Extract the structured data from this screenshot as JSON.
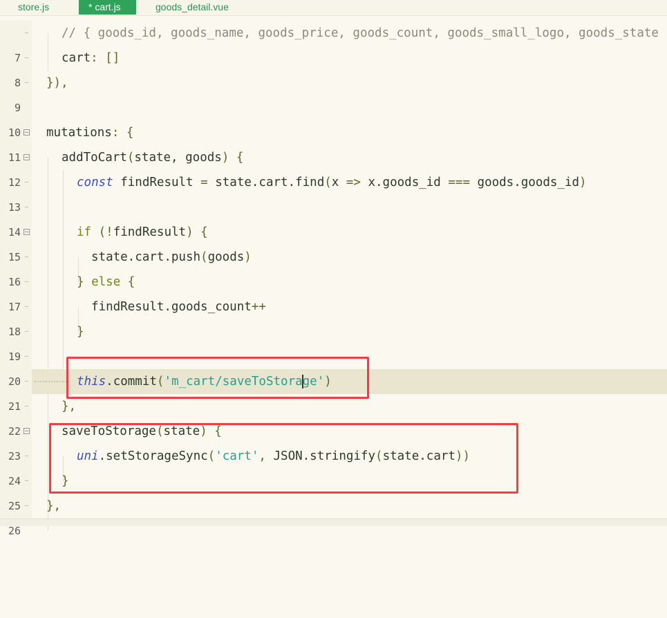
{
  "tabs": [
    {
      "label": "store.js",
      "active": false
    },
    {
      "label": "* cart.js",
      "active": true
    },
    {
      "label": "goods_detail.vue",
      "active": false
    }
  ],
  "colors": {
    "tab_active": "#2fa35a",
    "highlight_box": "#ef3e48",
    "current_line": "#e9e5cf"
  },
  "lines": [
    {
      "num": "7",
      "text": "    // { goods_id, goods_name, goods_price, goods_count, goods_small_logo, goods_state"
    },
    {
      "num": "8",
      "text": "    cart: []"
    },
    {
      "num": "9",
      "text": "  }),"
    },
    {
      "num": "10",
      "text": ""
    },
    {
      "num": "11",
      "text": "  mutations: {"
    },
    {
      "num": "12",
      "text": "    addToCart(state, goods) {"
    },
    {
      "num": "13",
      "text": "      const findResult = state.cart.find(x => x.goods_id === goods.goods_id)"
    },
    {
      "num": "14",
      "text": ""
    },
    {
      "num": "15",
      "text": "      if (!findResult) {"
    },
    {
      "num": "16",
      "text": "        state.cart.push(goods)"
    },
    {
      "num": "17",
      "text": "      } else {"
    },
    {
      "num": "18",
      "text": "        findResult.goods_count++"
    },
    {
      "num": "19",
      "text": "      }"
    },
    {
      "num": "20",
      "text": ""
    },
    {
      "num": "21",
      "text": "      this.commit('m_cart/saveToStorage')"
    },
    {
      "num": "22",
      "text": "    },"
    },
    {
      "num": "23",
      "text": "    saveToStorage(state) {"
    },
    {
      "num": "24",
      "text": "      uni.setStorageSync('cart', JSON.stringify(state.cart))"
    },
    {
      "num": "25",
      "text": "    }"
    },
    {
      "num": "26",
      "text": "  },"
    }
  ]
}
